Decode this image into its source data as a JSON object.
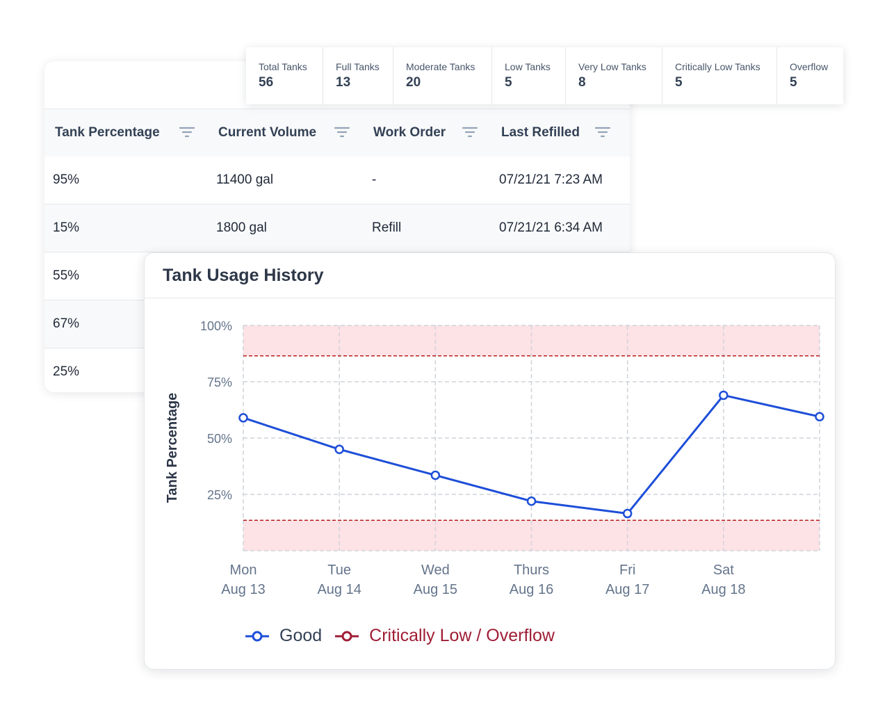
{
  "stats": [
    {
      "label": "Total Tanks",
      "value": "56"
    },
    {
      "label": "Full Tanks",
      "value": "13"
    },
    {
      "label": "Moderate Tanks",
      "value": "20"
    },
    {
      "label": "Low Tanks",
      "value": "5"
    },
    {
      "label": "Very Low Tanks",
      "value": "8"
    },
    {
      "label": "Critically Low Tanks",
      "value": "5"
    },
    {
      "label": "Overflow",
      "value": "5"
    }
  ],
  "table": {
    "columns": [
      "Tank Percentage",
      "Current Volume",
      "Work Order",
      "Last Refilled"
    ],
    "rows": [
      [
        "95%",
        "11400 gal",
        "-",
        "07/21/21 7:23 AM"
      ],
      [
        "15%",
        "1800 gal",
        "Refill",
        "07/21/21 6:34 AM"
      ],
      [
        "55%",
        "",
        "",
        ""
      ],
      [
        "67%",
        "",
        "",
        ""
      ],
      [
        "25%",
        "",
        "",
        ""
      ]
    ]
  },
  "chart_panel": {
    "title": "Tank Usage History"
  },
  "chart_data": {
    "type": "line",
    "title": "Tank Usage History",
    "ylabel": "Tank Percentage",
    "xlabel": "",
    "categories": [
      [
        "Mon",
        "Aug 13"
      ],
      [
        "Tue",
        "Aug 14"
      ],
      [
        "Wed",
        "Aug 15"
      ],
      [
        "Thurs",
        "Aug 16"
      ],
      [
        "Fri",
        "Aug 17"
      ],
      [
        "Sat",
        "Aug 18"
      ],
      [
        "",
        ""
      ]
    ],
    "series": [
      {
        "name": "Good",
        "values": [
          59,
          45,
          33.5,
          22,
          16.5,
          69,
          59.5
        ],
        "color": "#1d4ed8"
      }
    ],
    "yticks": [
      "100%",
      "75%",
      "50%",
      "25%"
    ],
    "ytick_values": [
      100,
      75,
      50,
      25
    ],
    "ylim": [
      0,
      100
    ],
    "thresholds": {
      "low": 13.5,
      "high": 86.5,
      "color": "#b91c1c",
      "band_color": "#fde2e6"
    },
    "grid": true,
    "legend": [
      {
        "name": "Good",
        "color": "#1d4ed8"
      },
      {
        "name": "Critically Low / Overflow",
        "color": "#9f1d35"
      }
    ],
    "legend_position": "bottom-left"
  }
}
